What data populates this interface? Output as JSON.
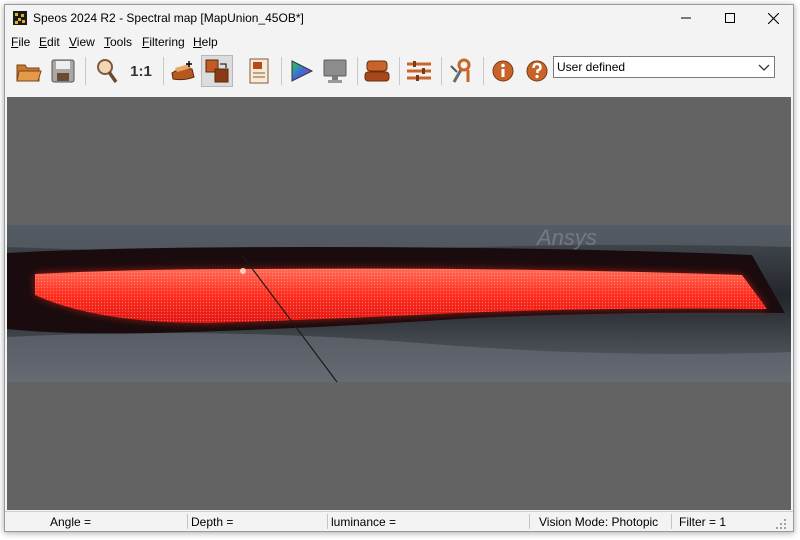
{
  "window": {
    "title": "Speos 2024 R2 - Spectral map [MapUnion_45OB*]"
  },
  "menu": {
    "file": {
      "accel": "F",
      "rest": "ile"
    },
    "edit": {
      "accel": "E",
      "rest": "dit"
    },
    "view": {
      "accel": "V",
      "rest": "iew"
    },
    "tools": {
      "accel": "T",
      "rest": "ools"
    },
    "filtering": {
      "accel": "F",
      "rest": "iltering"
    },
    "help": {
      "accel": "H",
      "rest": "elp"
    }
  },
  "toolbar": {
    "zoom_ratio_label": "1:1",
    "display_mode": "User defined"
  },
  "image": {
    "watermark": "Ansys"
  },
  "status": {
    "angle": "Angle =",
    "depth": "Depth =",
    "luminance": "luminance =",
    "vision_mode": "Vision Mode: Photopic",
    "filter": "Filter = 1"
  },
  "colors": {
    "viewport_bg": "#636363",
    "lamp_red": "#ff2a1c",
    "icon_accent": "#c8642a"
  },
  "icons": [
    "open-folder-icon",
    "save-icon",
    "zoom-icon",
    "zoom-1-1-icon",
    "hand-icon",
    "layers-icon",
    "document-icon",
    "color-triangle-icon",
    "monitor-icon",
    "lamp-icon",
    "sliders-icon",
    "tools-icon",
    "info-icon",
    "help-icon"
  ]
}
